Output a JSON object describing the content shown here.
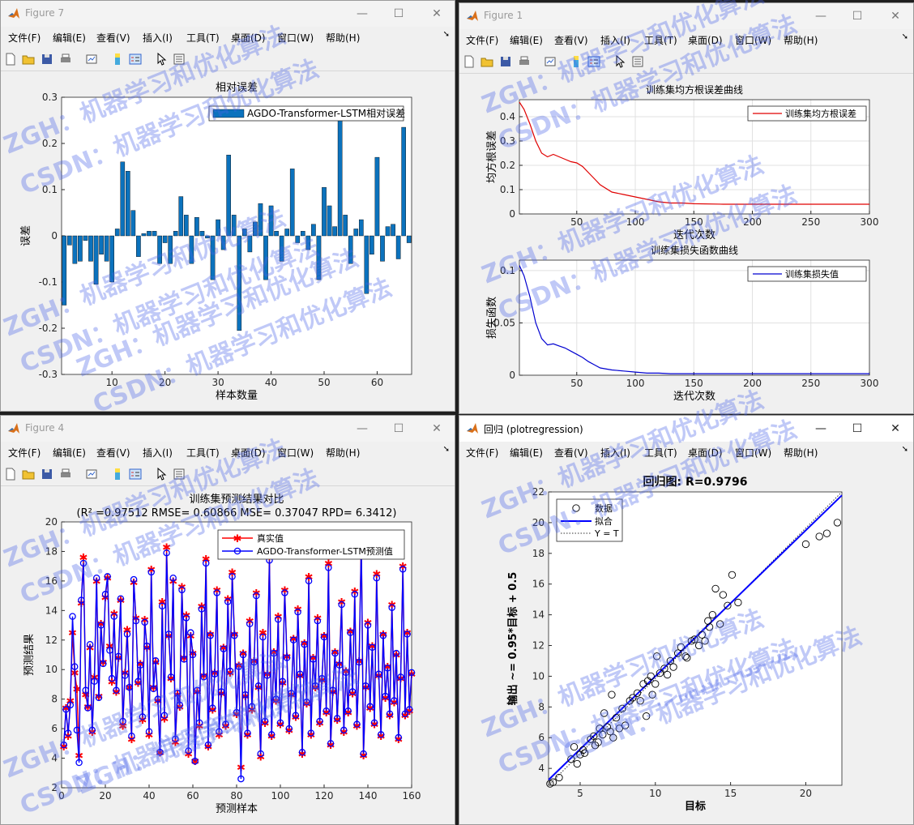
{
  "menus": [
    "文件(F)",
    "编辑(E)",
    "查看(V)",
    "插入(I)",
    "工具(T)",
    "桌面(D)",
    "窗口(W)",
    "帮助(H)"
  ],
  "windows": {
    "fig7": {
      "title": "Figure 7"
    },
    "fig1": {
      "title": "Figure 1"
    },
    "fig4": {
      "title": "Figure 4"
    },
    "reg": {
      "title": "回归 (plotregression)"
    }
  },
  "window_buttons": {
    "minimize": "—",
    "maximize": "☐",
    "close": "✕"
  },
  "watermark": {
    "line1": "ZGH：机器学习和优化算法",
    "line2": "CSDN：机器学习和优化算法",
    "color": "#4a63e8"
  },
  "colors": {
    "bar": "#0b72bd",
    "train_rmse": "#e00000",
    "train_loss": "#0000d0",
    "true_value": "#ff0000",
    "pred_value": "#0000ff",
    "fit": "#0000ff"
  },
  "chart_data": [
    {
      "id": "relative_error",
      "type": "bar",
      "title": "相对误差",
      "xlabel": "样本数量",
      "ylabel": "误差",
      "legend": [
        "AGDO-Transformer-LSTM相对误差"
      ],
      "legend_position": "top-right",
      "xlim": [
        0.5,
        66.5
      ],
      "ylim": [
        -0.3,
        0.3
      ],
      "xticks": [
        10,
        20,
        30,
        40,
        50,
        60
      ],
      "yticks": [
        -0.3,
        -0.2,
        -0.1,
        0,
        0.1,
        0.2,
        0.3
      ],
      "grid": false,
      "x": [
        1,
        2,
        3,
        4,
        5,
        6,
        7,
        8,
        9,
        10,
        11,
        12,
        13,
        14,
        15,
        16,
        17,
        18,
        19,
        20,
        21,
        22,
        23,
        24,
        25,
        26,
        27,
        28,
        29,
        30,
        31,
        32,
        33,
        34,
        35,
        36,
        37,
        38,
        39,
        40,
        41,
        42,
        43,
        44,
        45,
        46,
        47,
        48,
        49,
        50,
        51,
        52,
        53,
        54,
        55,
        56,
        57,
        58,
        59,
        60,
        61,
        62,
        63,
        64,
        65,
        66
      ],
      "values": [
        -0.15,
        -0.02,
        -0.06,
        -0.055,
        -0.01,
        -0.055,
        -0.105,
        -0.04,
        -0.055,
        -0.1,
        0.015,
        0.16,
        0.14,
        0.055,
        -0.045,
        0.005,
        0.01,
        0.01,
        -0.06,
        -0.015,
        -0.06,
        0.01,
        0.085,
        0.045,
        -0.06,
        0.04,
        0.01,
        -0.005,
        -0.095,
        0.035,
        -0.03,
        0.175,
        0.045,
        -0.205,
        0.015,
        -0.035,
        0.03,
        0.07,
        -0.095,
        0.065,
        0.01,
        -0.055,
        0.015,
        0.145,
        -0.015,
        0.01,
        -0.03,
        0.025,
        -0.095,
        0.105,
        0.065,
        0.02,
        0.25,
        0.045,
        -0.06,
        0.015,
        0.035,
        -0.125,
        -0.04,
        0.17,
        -0.055,
        0.02,
        0.025,
        -0.05,
        0.235,
        -0.015
      ]
    },
    {
      "id": "train_rmse",
      "type": "line",
      "title": "训练集均方根误差曲线",
      "xlabel": "迭代次数",
      "ylabel": "均方根误差",
      "legend": [
        "训练集均方根误差"
      ],
      "legend_position": "top-right",
      "xlim": [
        1,
        300
      ],
      "ylim": [
        0,
        0.47
      ],
      "xticks": [
        50,
        100,
        150,
        200,
        250,
        300
      ],
      "yticks": [
        0,
        0.1,
        0.2,
        0.3,
        0.4
      ],
      "grid": true,
      "x": [
        1,
        5,
        10,
        15,
        20,
        25,
        30,
        35,
        40,
        45,
        50,
        55,
        60,
        65,
        70,
        80,
        90,
        100,
        110,
        120,
        130,
        140,
        150,
        175,
        200,
        225,
        250,
        275,
        300
      ],
      "y": [
        0.46,
        0.43,
        0.37,
        0.3,
        0.25,
        0.235,
        0.245,
        0.235,
        0.225,
        0.215,
        0.21,
        0.195,
        0.17,
        0.145,
        0.12,
        0.09,
        0.08,
        0.07,
        0.06,
        0.05,
        0.045,
        0.045,
        0.042,
        0.04,
        0.04,
        0.04,
        0.04,
        0.04,
        0.04
      ]
    },
    {
      "id": "train_loss",
      "type": "line",
      "title": "训练集损失函数曲线",
      "xlabel": "迭代次数",
      "ylabel": "损失函数",
      "legend": [
        "训练集损失值"
      ],
      "legend_position": "top-right",
      "xlim": [
        1,
        300
      ],
      "ylim": [
        0,
        0.11
      ],
      "xticks": [
        50,
        100,
        150,
        200,
        250,
        300
      ],
      "yticks": [
        0,
        0.05,
        0.1
      ],
      "grid": true,
      "x": [
        1,
        5,
        10,
        15,
        20,
        25,
        30,
        35,
        40,
        45,
        50,
        55,
        60,
        65,
        70,
        80,
        90,
        100,
        110,
        120,
        130,
        140,
        150,
        175,
        200,
        225,
        250,
        275,
        300
      ],
      "y": [
        0.105,
        0.095,
        0.075,
        0.05,
        0.035,
        0.029,
        0.03,
        0.028,
        0.026,
        0.023,
        0.02,
        0.017,
        0.013,
        0.01,
        0.007,
        0.005,
        0.004,
        0.003,
        0.002,
        0.002,
        0.0015,
        0.0015,
        0.0015,
        0.0015,
        0.0015,
        0.0015,
        0.0015,
        0.0015,
        0.0015
      ]
    },
    {
      "id": "train_prediction_compare",
      "type": "line",
      "title": "训练集预测结果对比",
      "subtitle": "(R² =0.97512 RMSE= 0.60866 MSE= 0.37047 RPD= 6.3412)",
      "xlabel": "预测样本",
      "ylabel": "预测结果",
      "legend_position": "top-right",
      "xlim": [
        0,
        160
      ],
      "ylim": [
        2,
        20
      ],
      "xticks": [
        0,
        20,
        40,
        60,
        80,
        100,
        120,
        140,
        160
      ],
      "yticks": [
        2,
        4,
        6,
        8,
        10,
        12,
        14,
        16,
        18,
        20
      ],
      "grid": false,
      "series": [
        {
          "name": "真实值",
          "marker": "*",
          "values": [
            4.8,
            7.4,
            5.5,
            7.9,
            12.5,
            9.8,
            8.7,
            4.2,
            14.5,
            17.6,
            8.3,
            7.5,
            11.5,
            5.8,
            9.5,
            16,
            8.2,
            13.1,
            10.5,
            14.9,
            16.2,
            11.6,
            9.2,
            13.8,
            8.5,
            10.8,
            14.7,
            6.2,
            9.8,
            12.7,
            8.8,
            5.3,
            15.9,
            13.5,
            9.1,
            10.4,
            6.6,
            13.4,
            11.5,
            5.6,
            16.8,
            8.8,
            10.5,
            7.9,
            4.4,
            14.6,
            6.7,
            18.3,
            12.3,
            9.4,
            16,
            5.1,
            8.3,
            7.5,
            15.6,
            10.8,
            13.7,
            4.3,
            12.3,
            11.1,
            3.8,
            8.5,
            6.2,
            14.3,
            9.6,
            17.5,
            4.8,
            12.4,
            7.3,
            9.8,
            15.4,
            5.6,
            8.4,
            11.5,
            6.2,
            14.8,
            9.8,
            16.6,
            12.4,
            7,
            10.3,
            3.4,
            11.1,
            8.2,
            5.6,
            13.3,
            7.3,
            10.6,
            15.2,
            8.8,
            4.1,
            12.5,
            6.4,
            9.7,
            17.8,
            5.5,
            11.2,
            7.9,
            13.6,
            6.3,
            9.1,
            15.4,
            10.9,
            5.9,
            8.3,
            12.1,
            6.8,
            14.1,
            9.6,
            4.3,
            11.8,
            7.7,
            16.3,
            5.6,
            10.8,
            8.8,
            13.5,
            6.4,
            9.3,
            12.3,
            7.1,
            17.2,
            4.9,
            8.5,
            11.2,
            6.6,
            10.4,
            14.6,
            5.8,
            9.9,
            7.1,
            12.6,
            8.4,
            15.3,
            6.2,
            10.6,
            19,
            4.2,
            8.8,
            13.2,
            7.4,
            11.6,
            6.3,
            16.5,
            9.6,
            5.5,
            12.4,
            8.1,
            10.2,
            6.9,
            14.4,
            7.8,
            11,
            5.3,
            9.4,
            17,
            6.9,
            12.5,
            7.2,
            9.7
          ]
        },
        {
          "name": "AGDO-Transformer-LSTM预测值",
          "marker": "o",
          "values": [
            4.9,
            7.3,
            5.7,
            7.6,
            13.6,
            10.2,
            5.9,
            3.7,
            14.7,
            17.2,
            8.6,
            7.4,
            11.7,
            5.9,
            9.2,
            16.2,
            8.1,
            13,
            10.4,
            15.1,
            16.3,
            11.3,
            9.4,
            13.6,
            8.6,
            10.9,
            14.8,
            6.5,
            9.6,
            12.4,
            8.8,
            5.5,
            16.1,
            13.3,
            9.2,
            10.3,
            6.8,
            13.2,
            11.6,
            5.8,
            16.6,
            8.7,
            10.6,
            8,
            4.4,
            14.3,
            6.9,
            17.9,
            12.4,
            9.5,
            16.2,
            5.3,
            8.4,
            7.6,
            15.4,
            10.7,
            13.5,
            4.5,
            12.5,
            11,
            3.8,
            8.6,
            6.4,
            14.1,
            9.5,
            17.2,
            4.9,
            12.3,
            7.4,
            9.7,
            15.2,
            5.8,
            8.5,
            11.4,
            6.3,
            14.6,
            9.9,
            16.3,
            12.3,
            7.1,
            10.2,
            2.6,
            11,
            8.3,
            5.7,
            13.1,
            7.5,
            10.5,
            15,
            8.9,
            4.3,
            12.2,
            6.5,
            9.6,
            17.4,
            5.6,
            11.1,
            8,
            13.4,
            6.4,
            9.2,
            15.2,
            10.8,
            6,
            8.4,
            12,
            6.9,
            13.9,
            9.7,
            4.4,
            11.7,
            7.8,
            16,
            5.7,
            10.7,
            8.9,
            13.3,
            6.5,
            9.4,
            12.2,
            7.2,
            16.9,
            5,
            8.6,
            11.1,
            6.7,
            10.3,
            14.4,
            5.9,
            9.8,
            7.2,
            12.5,
            8.5,
            15.1,
            6.3,
            10.5,
            18.6,
            4.3,
            8.9,
            13,
            7.5,
            11.5,
            6.4,
            16.2,
            9.7,
            5.6,
            12.3,
            8.2,
            10.1,
            7,
            14.2,
            7.9,
            11.1,
            5.4,
            9.5,
            16.8,
            7,
            12.4,
            7.3,
            9.8
          ]
        }
      ]
    },
    {
      "id": "regression",
      "type": "scatter",
      "title": "回归图: R=0.9796",
      "xlabel": "目标",
      "ylabel": "输出 ~= 0.95*目标 + 0.5",
      "legend": [
        "数据",
        "拟合",
        "Y = T"
      ],
      "legend_position": "top-left",
      "xlim": [
        2.9,
        22.4
      ],
      "ylim": [
        2.9,
        22
      ],
      "xticks": [
        5,
        10,
        15,
        20
      ],
      "yticks": [
        4,
        6,
        8,
        10,
        12,
        14,
        16,
        18,
        20,
        22
      ],
      "grid": false,
      "fit": {
        "slope": 0.95,
        "intercept": 0.5
      },
      "points": [
        [
          3,
          3
        ],
        [
          3.2,
          3.1
        ],
        [
          3.6,
          3.4
        ],
        [
          4.4,
          4.6
        ],
        [
          4.6,
          5.4
        ],
        [
          4.8,
          4.3
        ],
        [
          5,
          4.9
        ],
        [
          5.2,
          5.2
        ],
        [
          5.3,
          5
        ],
        [
          5.7,
          5.9
        ],
        [
          5.9,
          6.1
        ],
        [
          6,
          5.5
        ],
        [
          6.2,
          5.7
        ],
        [
          6.3,
          6.6
        ],
        [
          6.5,
          6.2
        ],
        [
          6.6,
          7.6
        ],
        [
          6.8,
          6.7
        ],
        [
          7,
          6.4
        ],
        [
          7.1,
          8.8
        ],
        [
          7.2,
          6
        ],
        [
          7.4,
          7.3
        ],
        [
          7.6,
          6.6
        ],
        [
          7.8,
          7.9
        ],
        [
          8,
          6.8
        ],
        [
          8.3,
          8.4
        ],
        [
          8.5,
          8.6
        ],
        [
          8.8,
          8.9
        ],
        [
          9,
          8.4
        ],
        [
          9.2,
          9.5
        ],
        [
          9.4,
          7.4
        ],
        [
          9.5,
          9.7
        ],
        [
          9.7,
          10
        ],
        [
          9.8,
          8.8
        ],
        [
          10,
          9.5
        ],
        [
          10.1,
          11.3
        ],
        [
          10.3,
          10.2
        ],
        [
          10.6,
          10.5
        ],
        [
          10.8,
          10.1
        ],
        [
          11,
          11
        ],
        [
          11.2,
          10.6
        ],
        [
          11.5,
          11.5
        ],
        [
          11.7,
          11.9
        ],
        [
          12,
          11.3
        ],
        [
          12.1,
          11.2
        ],
        [
          12.4,
          12.3
        ],
        [
          12.6,
          12.4
        ],
        [
          12.9,
          12
        ],
        [
          13.1,
          12.7
        ],
        [
          13.3,
          12.3
        ],
        [
          13.5,
          13.6
        ],
        [
          13.6,
          13.2
        ],
        [
          13.8,
          14
        ],
        [
          14,
          15.7
        ],
        [
          14.3,
          13.4
        ],
        [
          14.5,
          15.3
        ],
        [
          14.8,
          14.6
        ],
        [
          15.1,
          16.6
        ],
        [
          15.5,
          14.8
        ],
        [
          20,
          18.6
        ],
        [
          20.9,
          19.1
        ],
        [
          21.4,
          19.3
        ],
        [
          22.1,
          20
        ]
      ]
    }
  ]
}
